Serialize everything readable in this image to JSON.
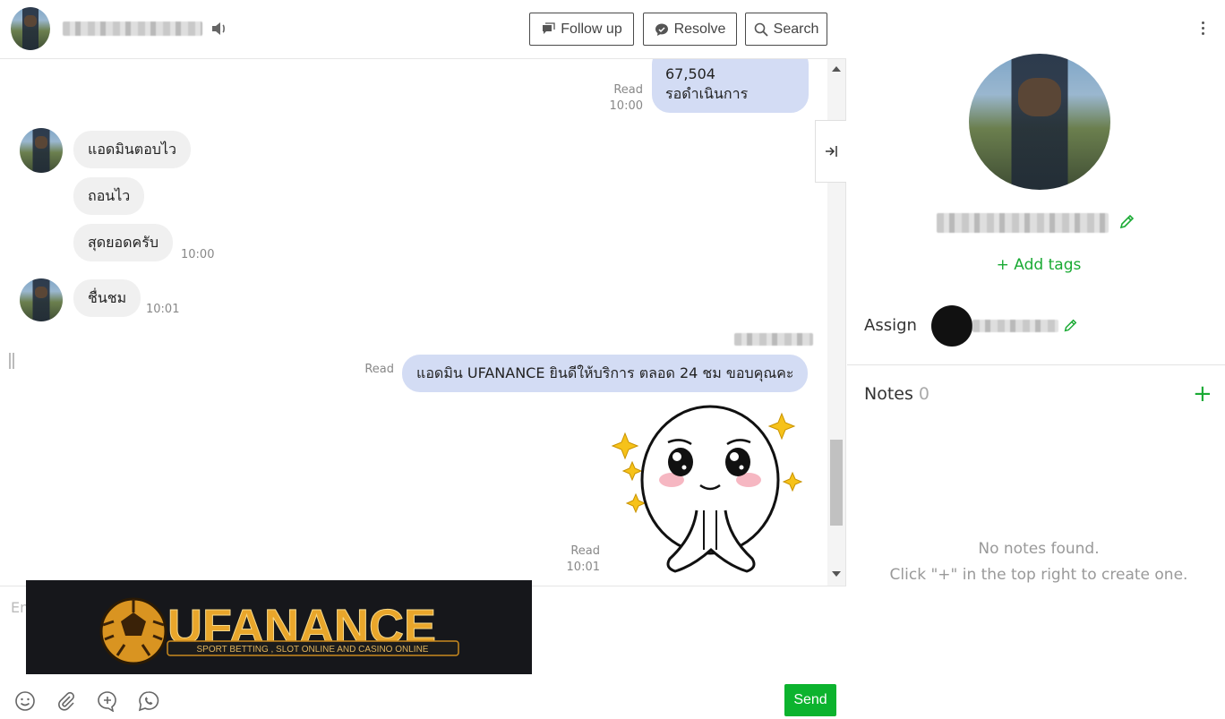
{
  "header": {
    "follow_up_label": "Follow up",
    "resolve_label": "Resolve",
    "search_label": "Search"
  },
  "messages": {
    "top_partial": "67,504",
    "top_status": "รอดำเนินการ",
    "top_read": "Read",
    "top_time": "10:00",
    "in_1": "แอดมินตอบไว",
    "in_2": "ถอนไว",
    "in_3": "สุดยอดครับ",
    "in_3_time": "10:00",
    "in_4": "ชื่นชม",
    "in_4_time": "10:01",
    "out_1_read": "Read",
    "out_1": "แอดมิน UFANANCE ยินดีให้บริการ ตลอด 24 ชม ขอบคุณคะ",
    "sticker_read": "Read",
    "sticker_time": "10:01"
  },
  "composer": {
    "placeholder": "En",
    "send_label": "Send"
  },
  "banner": {
    "brand": "UFANANCE",
    "tagline": "SPORT BETTING , SLOT ONLINE AND CASINO ONLINE"
  },
  "profile": {
    "add_tags": "+ Add tags",
    "assign_label": "Assign",
    "notes_title": "Notes",
    "notes_count": "0",
    "empty_line_1": "No notes found.",
    "empty_line_2": "Click \"+\" in the top right to create one."
  },
  "colors": {
    "accent_green": "#1aaa34",
    "send_green": "#0cb32e",
    "outgoing_bubble": "#d3dcf4",
    "incoming_bubble": "#f0f0f0"
  }
}
